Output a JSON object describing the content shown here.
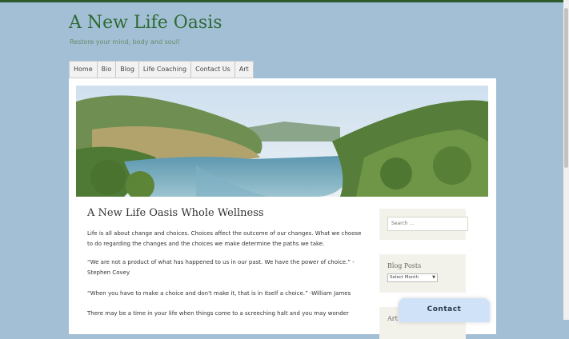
{
  "site": {
    "title": "A New Life Oasis",
    "tagline": "Restore your mind, body and soul!"
  },
  "nav": {
    "items": [
      "Home",
      "Bio",
      "Blog",
      "Life Coaching",
      "Contact Us",
      "Art"
    ]
  },
  "post": {
    "title": "A New Life Oasis Whole Wellness",
    "paragraphs": [
      "Life is all about change and choices. Choices affect the outcome of our changes. What we choose to do regarding the changes and the choices we make determine the paths we take.",
      "“We are not a product of what has happened to us in our past. We have the power of choice.” - Stephen Covey",
      "“When you have to make a choice and don't make it, that is in itself a choice.” -William James",
      "There may be a time in your life when things come to a screeching halt and you may wonder"
    ]
  },
  "sidebar": {
    "search_placeholder": "Search …",
    "blog_posts_title": "Blog Posts",
    "archive_select": "Select Month",
    "art_title": "Art"
  },
  "contact_tab": {
    "label": "Contact"
  },
  "colors": {
    "background": "#a3bfd6",
    "accent": "#2e6b33",
    "widget_bg": "#f3f2ea"
  }
}
